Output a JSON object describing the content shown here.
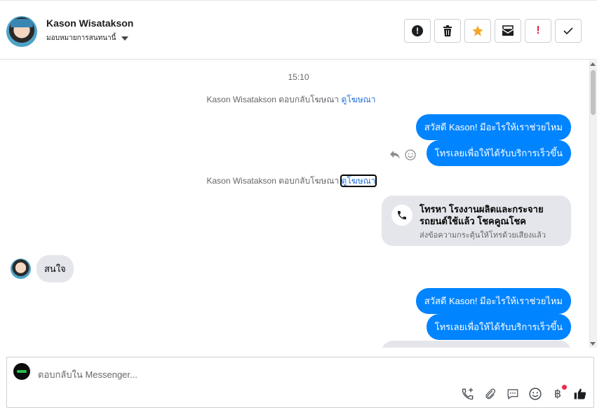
{
  "header": {
    "contact_name": "Kason Wisatakson",
    "assign_label": "มอบหมายการสนทนานี้",
    "actions": [
      {
        "name": "spam",
        "icon": "exclamation-circle-icon"
      },
      {
        "name": "delete",
        "icon": "trash-icon"
      },
      {
        "name": "star",
        "icon": "star-icon",
        "color": "#f5a623"
      },
      {
        "name": "move",
        "icon": "mail-icon"
      },
      {
        "name": "important",
        "icon": "exclamation-icon",
        "color": "#e41e3f"
      },
      {
        "name": "done",
        "icon": "check-icon"
      }
    ]
  },
  "conversation": {
    "timestamp": "15:10",
    "ad_reply_1": {
      "text": "Kason Wisatakson ตอบกลับโฆษณา",
      "link": "ดูโฆษณา"
    },
    "messages_1": [
      "สวัสดี Kason! มีอะไรให้เราช่วยไหม",
      "โทรเลยเพื่อให้ได้รับบริการเร็วขึ้น"
    ],
    "ad_reply_2": {
      "text": "Kason Wisatakson ตอบกลับโฆษณา",
      "link": "ดูโฆษณา"
    },
    "call_card": {
      "title": "โทรหา โรงงานผลิตและกระจายรถยนต์ใช้แล้ว โชคคูณโชค",
      "subtitle": "ส่งข้อความกระตุ้นให้โทรด้วยเสียงแล้ว"
    },
    "incoming_message": "สนใจ",
    "messages_2": [
      "สวัสดี Kason! มีอะไรให้เราช่วยไหม",
      "โทรเลยเพื่อให้ได้รับบริการเร็วขึ้น"
    ]
  },
  "composer": {
    "placeholder": "ตอบกลับใน Messenger...",
    "tools": [
      "call-add-icon",
      "attachment-icon",
      "saved-replies-icon",
      "emoji-icon",
      "payment-icon",
      "like-icon"
    ],
    "notification_color": "#f02849"
  },
  "colors": {
    "accent": "#0084ff",
    "link": "#216fdb",
    "bubble_in": "#e4e6eb"
  }
}
